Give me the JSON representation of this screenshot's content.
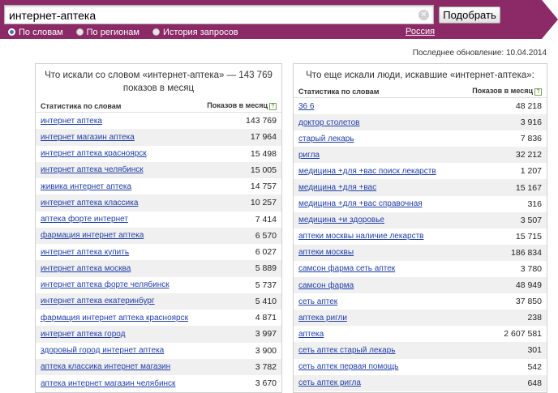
{
  "search": {
    "value": "интернет-аптека",
    "clear_icon": "✕",
    "submit_label": "Подобрать"
  },
  "modes": [
    {
      "label": "По словам",
      "active": true
    },
    {
      "label": "По регионам",
      "active": false
    },
    {
      "label": "История запросов",
      "active": false
    }
  ],
  "region": "Россия",
  "updated": "Последнее обновление: 10.04.2014",
  "colors": {
    "header": "#8b2a67",
    "link": "#1f3ea8",
    "row_alt": "#f0f0f0"
  },
  "left_panel": {
    "title": "Что искали со словом «интернет-аптека» — 143 769 показов в месяц",
    "col_phrase": "Статистика по словам",
    "col_count": "Показов в месяц",
    "help": "?",
    "rows": [
      {
        "phrase": "интернет аптека",
        "count": "143 769"
      },
      {
        "phrase": "интернет магазин аптека",
        "count": "17 964"
      },
      {
        "phrase": "интернет аптека красноярск",
        "count": "15 498"
      },
      {
        "phrase": "интернет аптека челябинск",
        "count": "15 005"
      },
      {
        "phrase": "живика интернет аптека",
        "count": "14 757"
      },
      {
        "phrase": "интернет аптека классика",
        "count": "10 257"
      },
      {
        "phrase": "аптека форте интернет",
        "count": "7 414"
      },
      {
        "phrase": "фармация интернет аптека",
        "count": "6 570"
      },
      {
        "phrase": "интернет аптека купить",
        "count": "6 027"
      },
      {
        "phrase": "интернет аптека москва",
        "count": "5 889"
      },
      {
        "phrase": "интернет аптека форте челябинск",
        "count": "5 737"
      },
      {
        "phrase": "интернет аптека екатеринбург",
        "count": "5 410"
      },
      {
        "phrase": "фармация интернет аптека красноярск",
        "count": "4 871"
      },
      {
        "phrase": "интернет аптека город",
        "count": "3 997"
      },
      {
        "phrase": "здоровый город интернет аптека",
        "count": "3 900"
      },
      {
        "phrase": "аптека классика интернет магазин",
        "count": "3 782"
      },
      {
        "phrase": "аптека интернет магазин челябинск",
        "count": "3 670"
      }
    ]
  },
  "right_panel": {
    "title": "Что еще искали люди, искавшие «интернет-аптека»:",
    "col_phrase": "Статистика по словам",
    "col_count": "Показов в месяц",
    "help": "?",
    "rows": [
      {
        "phrase": "36 6",
        "count": "48 218"
      },
      {
        "phrase": "доктор столетов",
        "count": "3 916"
      },
      {
        "phrase": "старый лекарь",
        "count": "7 836"
      },
      {
        "phrase": "ригла",
        "count": "32 212"
      },
      {
        "phrase": "медицина +для +вас поиск лекарств",
        "count": "1 207"
      },
      {
        "phrase": "медицина +для +вас",
        "count": "15 167"
      },
      {
        "phrase": "медицина +для +вас справочная",
        "count": "316"
      },
      {
        "phrase": "медицина +и здоровье",
        "count": "3 507"
      },
      {
        "phrase": "аптеки москвы наличие лекарств",
        "count": "15 715"
      },
      {
        "phrase": "аптеки москвы",
        "count": "186 834"
      },
      {
        "phrase": "самсон фарма сеть аптек",
        "count": "3 780"
      },
      {
        "phrase": "самсон фарма",
        "count": "48 949"
      },
      {
        "phrase": "сеть аптек",
        "count": "37 850"
      },
      {
        "phrase": "аптека ригли",
        "count": "238"
      },
      {
        "phrase": "аптека",
        "count": "2 607 581"
      },
      {
        "phrase": "сеть аптек старый лекарь",
        "count": "301"
      },
      {
        "phrase": "сеть аптек первая помощь",
        "count": "542"
      },
      {
        "phrase": "сеть аптек ригла",
        "count": "648"
      }
    ]
  }
}
